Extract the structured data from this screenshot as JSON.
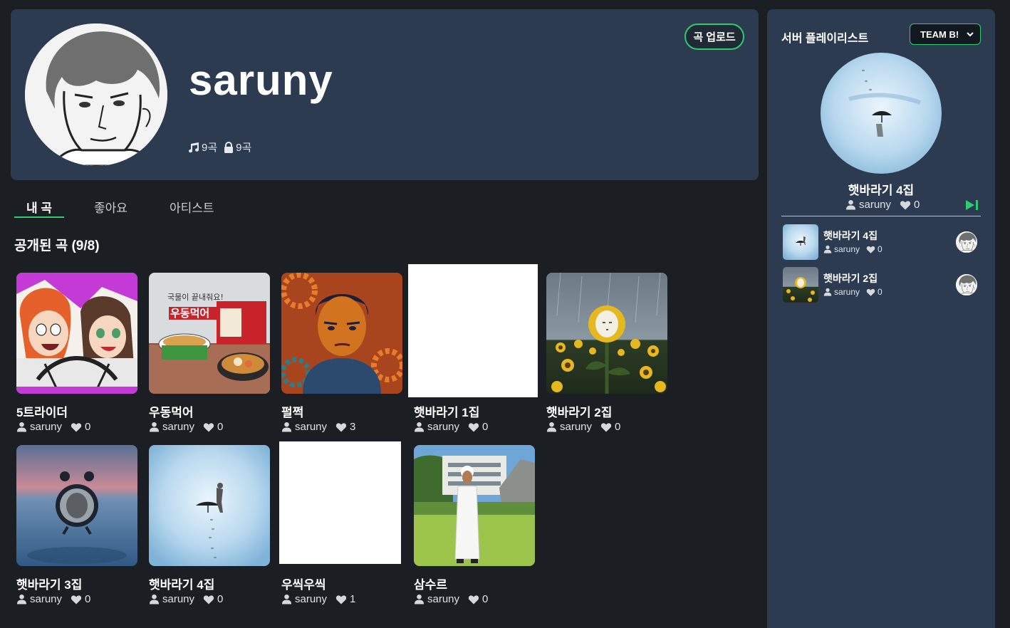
{
  "profile": {
    "username": "saruny",
    "songs_count": "9곡",
    "private_count": "9곡",
    "upload_label": "곡 업로드"
  },
  "tabs": [
    {
      "label": "내 곡",
      "active": true
    },
    {
      "label": "좋아요",
      "active": false
    },
    {
      "label": "아티스트",
      "active": false
    }
  ],
  "section_title": "공개된 곡 (9/8)",
  "songs": [
    {
      "title": "5트라이더",
      "artist": "saruny",
      "likes": "0"
    },
    {
      "title": "우동먹어",
      "artist": "saruny",
      "likes": "0"
    },
    {
      "title": "펄쩍",
      "artist": "saruny",
      "likes": "3"
    },
    {
      "title": "햇바라기 1집",
      "artist": "saruny",
      "likes": "0"
    },
    {
      "title": "햇바라기 2집",
      "artist": "saruny",
      "likes": "0"
    },
    {
      "title": "햇바라기 3집",
      "artist": "saruny",
      "likes": "0"
    },
    {
      "title": "햇바라기 4집",
      "artist": "saruny",
      "likes": "0"
    },
    {
      "title": "우씩우씩",
      "artist": "saruny",
      "likes": "1"
    },
    {
      "title": "삼수르",
      "artist": "saruny",
      "likes": "0"
    }
  ],
  "cover_texts": {
    "udong_banner": "국물이 끝내줘요!",
    "udong_name": "우동먹어"
  },
  "playlist": {
    "title": "서버 플레이리스트",
    "team_select": "TEAM B!",
    "now_playing": {
      "title": "햇바라기 4집",
      "artist": "saruny",
      "likes": "0"
    },
    "items": [
      {
        "title": "햇바라기 4집",
        "artist": "saruny",
        "likes": "0"
      },
      {
        "title": "햇바라기 2집",
        "artist": "saruny",
        "likes": "0"
      }
    ]
  },
  "colors": {
    "accent": "#2ecc71",
    "panel": "#2c3b50",
    "background": "#1b1e23"
  }
}
